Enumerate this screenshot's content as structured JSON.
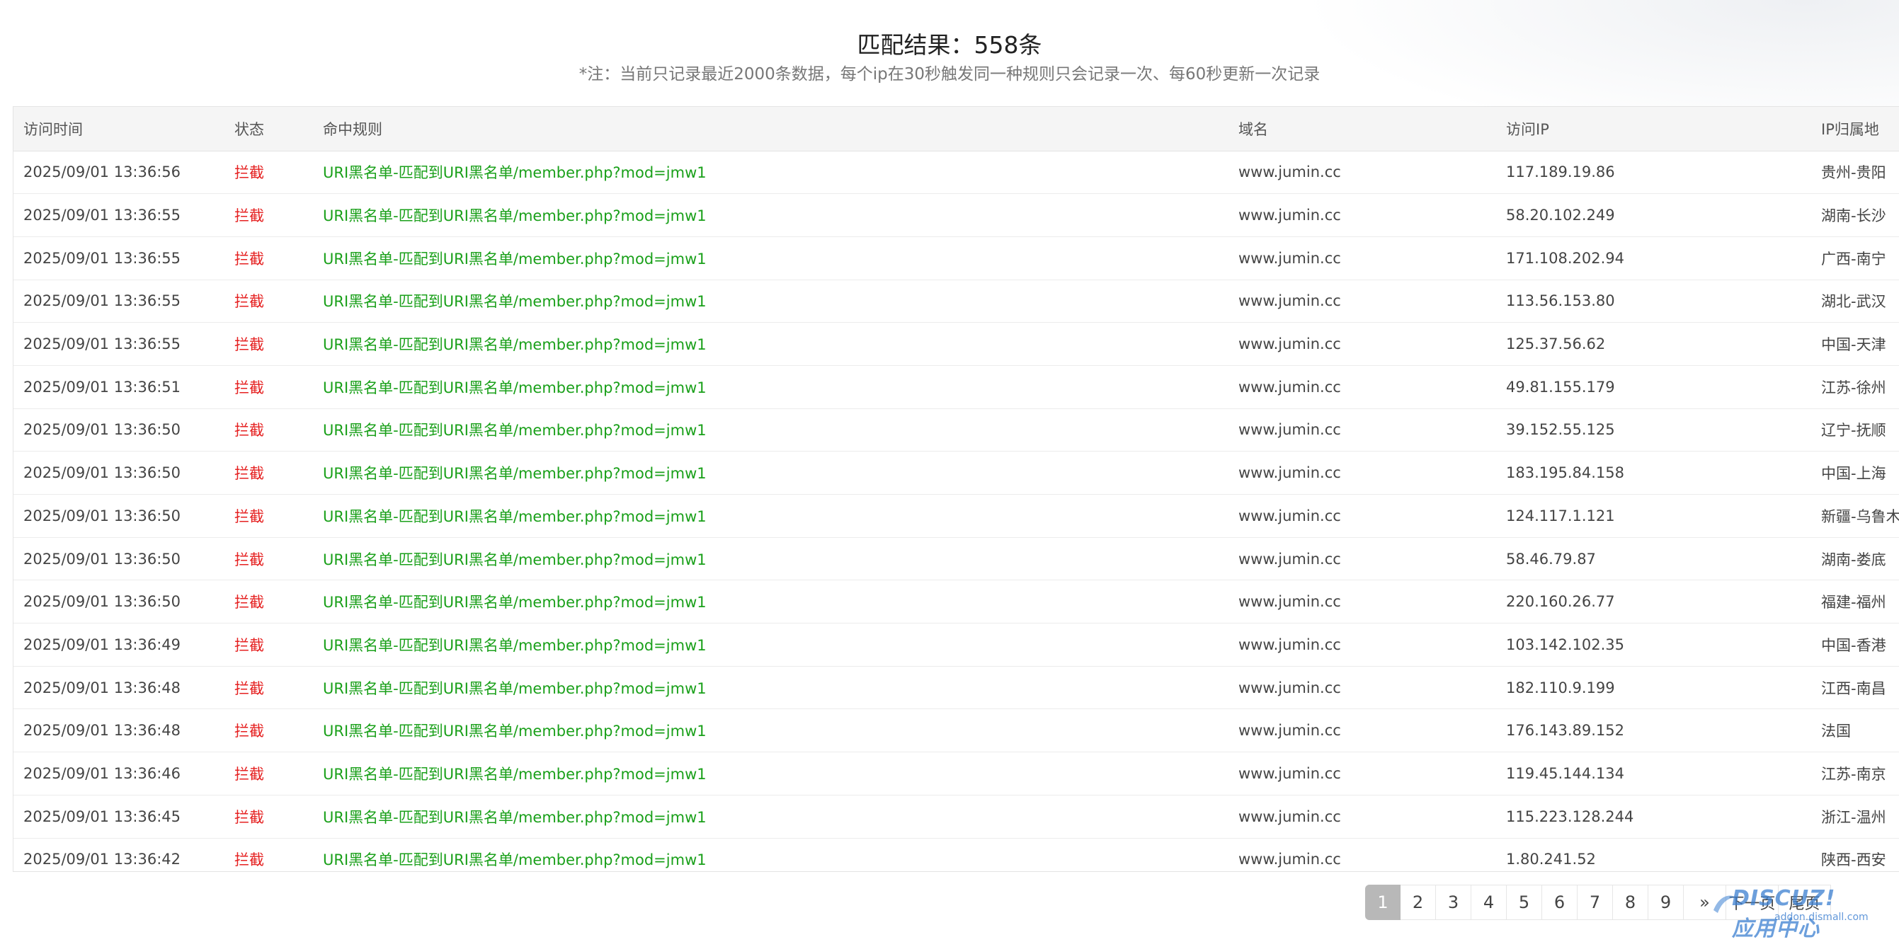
{
  "header": {
    "title": "匹配结果：558条",
    "note": "*注：当前只记录最近2000条数据，每个ip在30秒触发同一种规则只会记录一次、每60秒更新一次记录"
  },
  "table": {
    "columns": [
      "访问时间",
      "状态",
      "命中规则",
      "域名",
      "访问IP",
      "IP归属地"
    ],
    "rows": [
      [
        "2025/09/01 13:36:56",
        "拦截",
        "URI黑名单-匹配到URI黑名单/member.php?mod=jmw1",
        "www.jumin.cc",
        "117.189.19.86",
        "贵州-贵阳"
      ],
      [
        "2025/09/01 13:36:55",
        "拦截",
        "URI黑名单-匹配到URI黑名单/member.php?mod=jmw1",
        "www.jumin.cc",
        "58.20.102.249",
        "湖南-长沙"
      ],
      [
        "2025/09/01 13:36:55",
        "拦截",
        "URI黑名单-匹配到URI黑名单/member.php?mod=jmw1",
        "www.jumin.cc",
        "171.108.202.94",
        "广西-南宁"
      ],
      [
        "2025/09/01 13:36:55",
        "拦截",
        "URI黑名单-匹配到URI黑名单/member.php?mod=jmw1",
        "www.jumin.cc",
        "113.56.153.80",
        "湖北-武汉"
      ],
      [
        "2025/09/01 13:36:55",
        "拦截",
        "URI黑名单-匹配到URI黑名单/member.php?mod=jmw1",
        "www.jumin.cc",
        "125.37.56.62",
        "中国-天津"
      ],
      [
        "2025/09/01 13:36:51",
        "拦截",
        "URI黑名单-匹配到URI黑名单/member.php?mod=jmw1",
        "www.jumin.cc",
        "49.81.155.179",
        "江苏-徐州"
      ],
      [
        "2025/09/01 13:36:50",
        "拦截",
        "URI黑名单-匹配到URI黑名单/member.php?mod=jmw1",
        "www.jumin.cc",
        "39.152.55.125",
        "辽宁-抚顺"
      ],
      [
        "2025/09/01 13:36:50",
        "拦截",
        "URI黑名单-匹配到URI黑名单/member.php?mod=jmw1",
        "www.jumin.cc",
        "183.195.84.158",
        "中国-上海"
      ],
      [
        "2025/09/01 13:36:50",
        "拦截",
        "URI黑名单-匹配到URI黑名单/member.php?mod=jmw1",
        "www.jumin.cc",
        "124.117.1.121",
        "新疆-乌鲁木"
      ],
      [
        "2025/09/01 13:36:50",
        "拦截",
        "URI黑名单-匹配到URI黑名单/member.php?mod=jmw1",
        "www.jumin.cc",
        "58.46.79.87",
        "湖南-娄底"
      ],
      [
        "2025/09/01 13:36:50",
        "拦截",
        "URI黑名单-匹配到URI黑名单/member.php?mod=jmw1",
        "www.jumin.cc",
        "220.160.26.77",
        "福建-福州"
      ],
      [
        "2025/09/01 13:36:49",
        "拦截",
        "URI黑名单-匹配到URI黑名单/member.php?mod=jmw1",
        "www.jumin.cc",
        "103.142.102.35",
        "中国-香港"
      ],
      [
        "2025/09/01 13:36:48",
        "拦截",
        "URI黑名单-匹配到URI黑名单/member.php?mod=jmw1",
        "www.jumin.cc",
        "182.110.9.199",
        "江西-南昌"
      ],
      [
        "2025/09/01 13:36:48",
        "拦截",
        "URI黑名单-匹配到URI黑名单/member.php?mod=jmw1",
        "www.jumin.cc",
        "176.143.89.152",
        "法国"
      ],
      [
        "2025/09/01 13:36:46",
        "拦截",
        "URI黑名单-匹配到URI黑名单/member.php?mod=jmw1",
        "www.jumin.cc",
        "119.45.144.134",
        "江苏-南京"
      ],
      [
        "2025/09/01 13:36:45",
        "拦截",
        "URI黑名单-匹配到URI黑名单/member.php?mod=jmw1",
        "www.jumin.cc",
        "115.223.128.244",
        "浙江-温州"
      ],
      [
        "2025/09/01 13:36:42",
        "拦截",
        "URI黑名单-匹配到URI黑名单/member.php?mod=jmw1",
        "www.jumin.cc",
        "1.80.241.52",
        "陕西-西安"
      ]
    ]
  },
  "pagination": {
    "pages": [
      "1",
      "2",
      "3",
      "4",
      "5",
      "6",
      "7",
      "8",
      "9"
    ],
    "active_page": "1",
    "next_label": "»",
    "next_page_label": "下一页",
    "last_page_label": "尾页"
  },
  "watermark": {
    "logo_text": "DISCUZ!应用中心",
    "sub_text": "addon.dismall.com"
  },
  "colors": {
    "status_blocked": "#e52020",
    "rule_text": "#1aa01a",
    "header_bg": "#f5f5f5",
    "active_page_bg": "#b8b8b8",
    "watermark": "#3b7fd1"
  }
}
